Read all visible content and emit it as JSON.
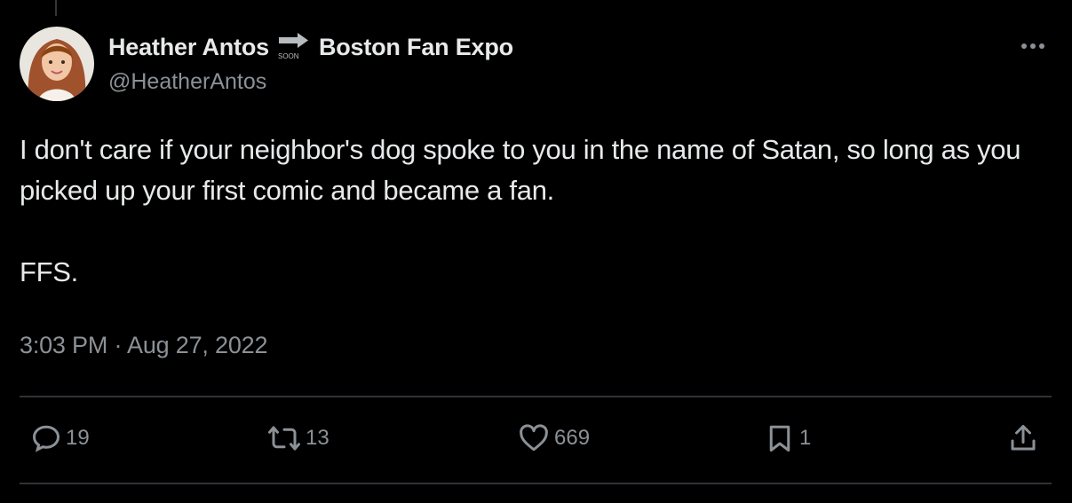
{
  "author": {
    "display_name": "Heather Antos",
    "display_name_suffix": "Boston Fan Expo",
    "handle": "@HeatherAntos",
    "arrow_badge_text": "SOON"
  },
  "tweet": {
    "text_paragraphs": [
      "I don't care if your neighbor's dog spoke to you in the name of Satan, so long as you picked up your first comic and became a fan.",
      "FFS."
    ],
    "timestamp": "3:03 PM · Aug 27, 2022"
  },
  "actions": {
    "reply_count": "19",
    "retweet_count": "13",
    "like_count": "669",
    "bookmark_count": "1"
  },
  "icons": {
    "more": "more-icon",
    "reply": "reply-icon",
    "retweet": "retweet-icon",
    "like": "heart-icon",
    "bookmark": "bookmark-icon",
    "share": "share-icon",
    "arrow": "arrow-right-icon"
  },
  "colors": {
    "background": "#000000",
    "text_primary": "#e7e9ea",
    "text_secondary": "#8b9196",
    "divider": "#2f3336"
  }
}
